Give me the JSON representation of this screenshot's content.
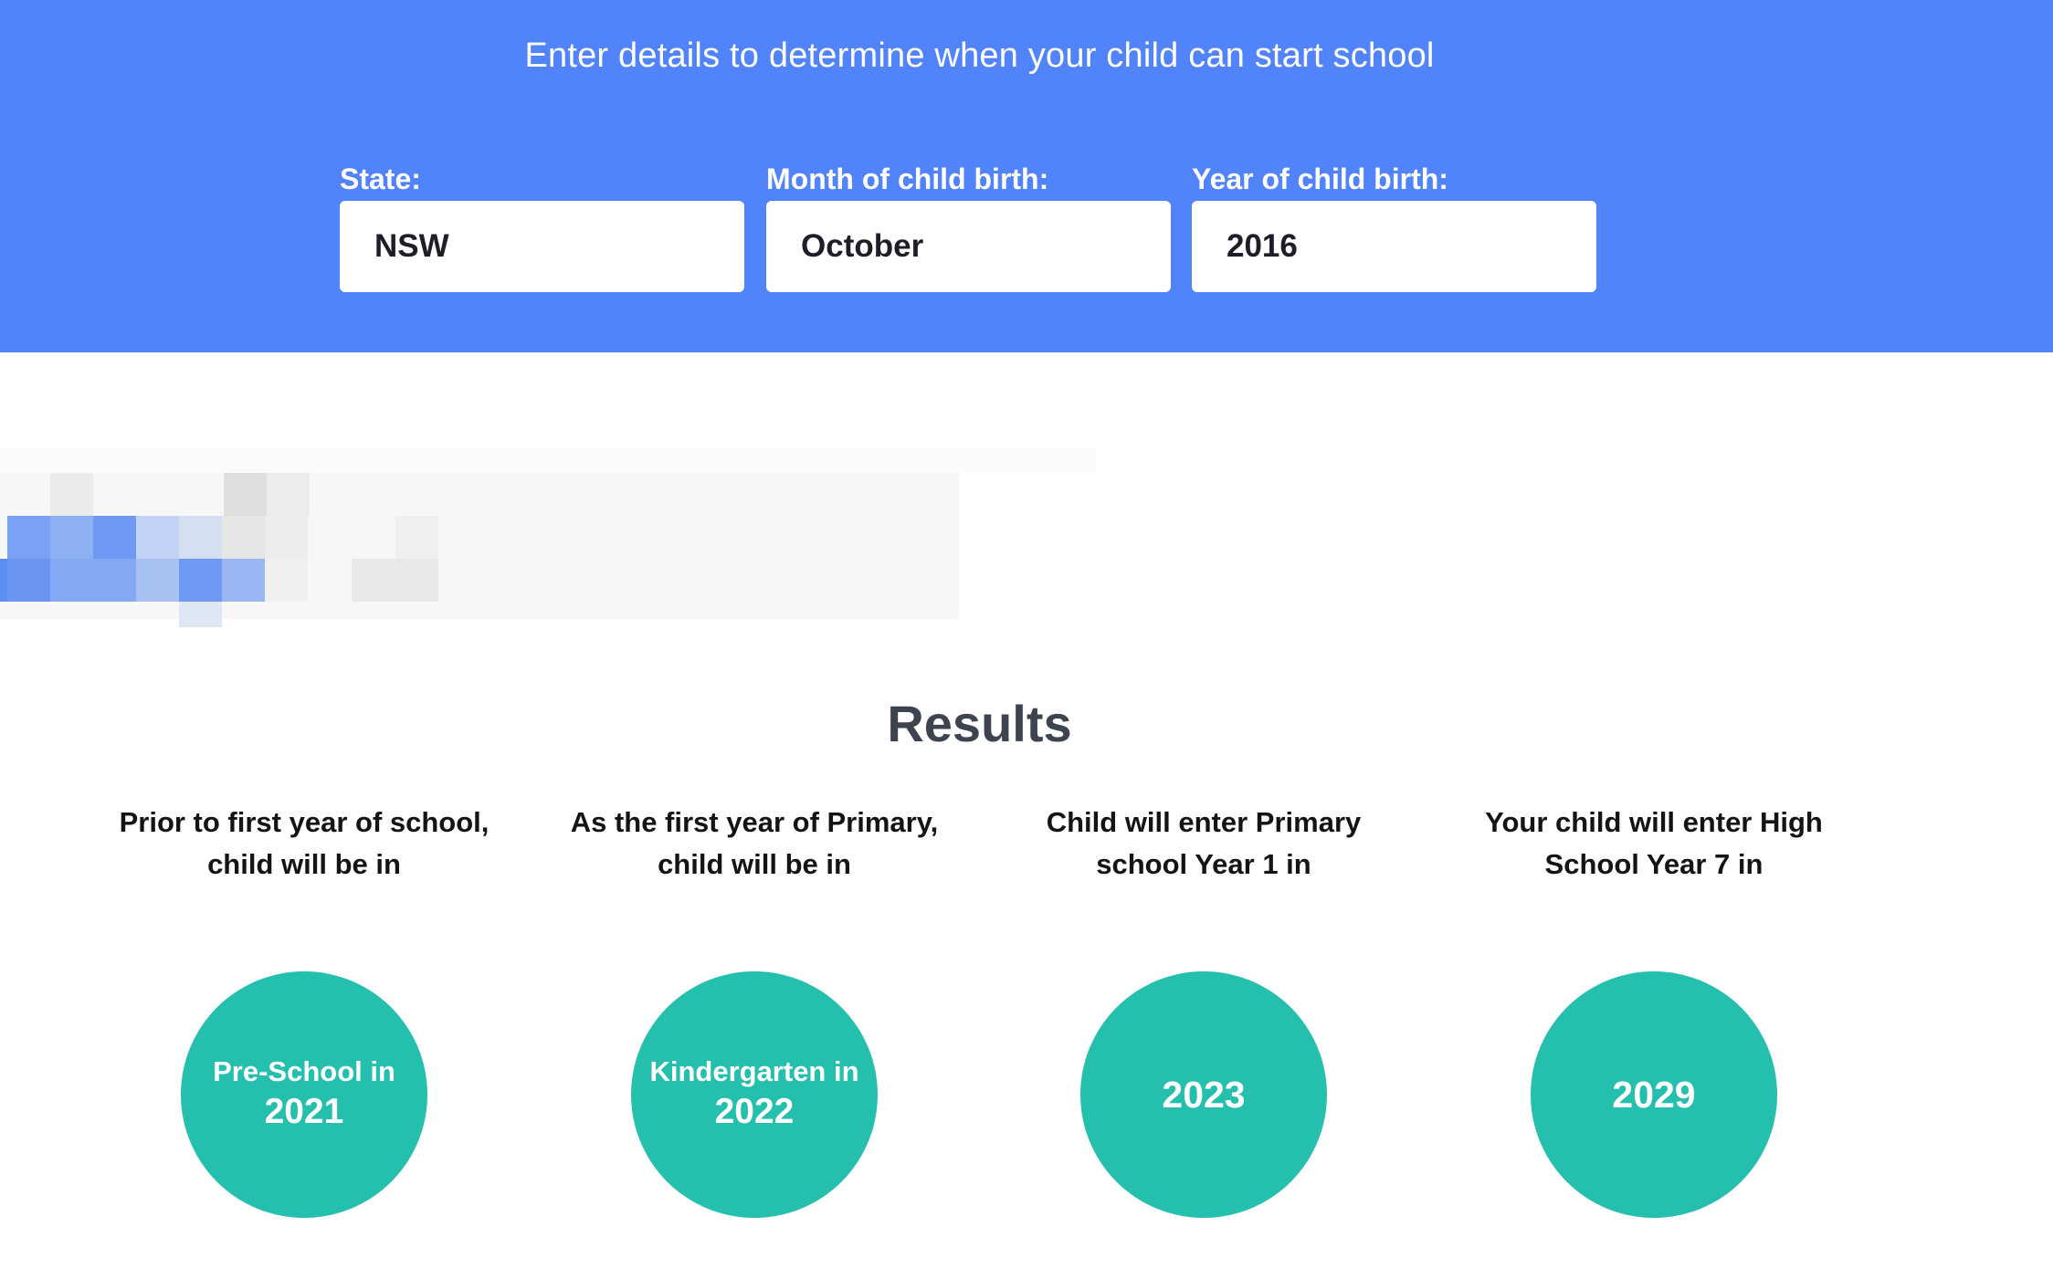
{
  "form": {
    "subtitle": "Enter details to determine when your child can start school",
    "state": {
      "label": "State:",
      "value": "NSW"
    },
    "month": {
      "label": "Month of child birth:",
      "value": "October"
    },
    "year": {
      "label": "Year of child birth:",
      "value": "2016"
    }
  },
  "results": {
    "title": "Results",
    "items": [
      {
        "caption_line1": "Prior to first year of school,",
        "caption_line2": "child will be in",
        "circle_label": "Pre-School in",
        "circle_year": "2021"
      },
      {
        "caption_line1": "As the first year of Primary,",
        "caption_line2": "child will be in",
        "circle_label": "Kindergarten in",
        "circle_year": "2022"
      },
      {
        "caption_line1": "Child will enter Primary",
        "caption_line2": "school Year 1 in",
        "circle_label": "",
        "circle_year": "2023"
      },
      {
        "caption_line1": "Your child will enter High",
        "caption_line2": "School Year 7 in",
        "circle_label": "",
        "circle_year": "2029"
      }
    ]
  },
  "colors": {
    "hero_bg": "#5183fb",
    "circle_bg": "#25bfae",
    "results_title": "#3d4450"
  }
}
